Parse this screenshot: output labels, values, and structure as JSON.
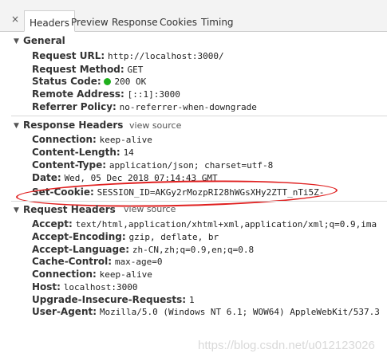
{
  "tabs": {
    "close_glyph": "×",
    "items": [
      "Headers",
      "Preview",
      "Response",
      "Cookies",
      "Timing"
    ],
    "active": "Headers"
  },
  "general": {
    "title": "General",
    "request_url": {
      "key": "Request URL:",
      "value": "http://localhost:3000/"
    },
    "request_method": {
      "key": "Request Method:",
      "value": "GET"
    },
    "status_code": {
      "key": "Status Code:",
      "value": "200 OK",
      "indicator_color": "#20b01e"
    },
    "remote_address": {
      "key": "Remote Address:",
      "value": "[::1]:3000"
    },
    "referrer_policy": {
      "key": "Referrer Policy:",
      "value": "no-referrer-when-downgrade"
    }
  },
  "response_headers": {
    "title": "Response Headers",
    "view_source": "view source",
    "rows": [
      {
        "key": "Connection:",
        "value": "keep-alive"
      },
      {
        "key": "Content-Length:",
        "value": "14"
      },
      {
        "key": "Content-Type:",
        "value": "application/json; charset=utf-8"
      },
      {
        "key": "Date:",
        "value": "Wed, 05 Dec 2018 07:14:43 GMT"
      },
      {
        "key": "Set-Cookie:",
        "value": "SESSION_ID=AKGy2rMozpRI28hWGsXHy2ZTT_nTi5Z-"
      }
    ],
    "highlight_color": "#e02020"
  },
  "request_headers": {
    "title": "Request Headers",
    "view_source": "view source",
    "rows": [
      {
        "key": "Accept:",
        "value": "text/html,application/xhtml+xml,application/xml;q=0.9,ima"
      },
      {
        "key": "Accept-Encoding:",
        "value": "gzip, deflate, br"
      },
      {
        "key": "Accept-Language:",
        "value": "zh-CN,zh;q=0.9,en;q=0.8"
      },
      {
        "key": "Cache-Control:",
        "value": "max-age=0"
      },
      {
        "key": "Connection:",
        "value": "keep-alive"
      },
      {
        "key": "Host:",
        "value": "localhost:3000"
      },
      {
        "key": "Upgrade-Insecure-Requests:",
        "value": "1"
      },
      {
        "key": "User-Agent:",
        "value": "Mozilla/5.0 (Windows NT 6.1; WOW64) AppleWebKit/537.3"
      }
    ]
  },
  "watermark": "https://blog.csdn.net/u012123026"
}
